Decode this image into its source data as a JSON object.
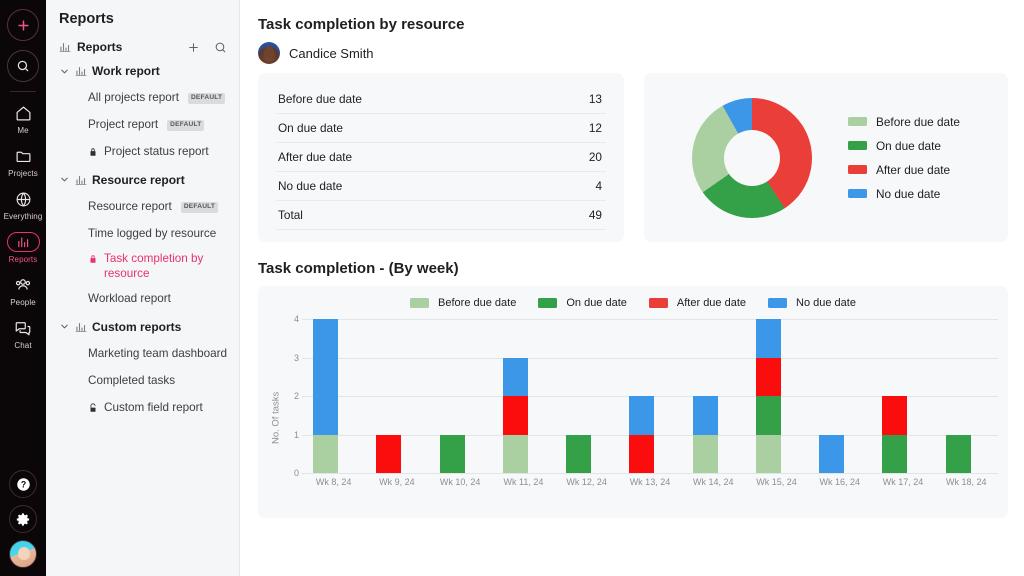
{
  "rail": {
    "add_label": "add-new",
    "search_label": "search",
    "items": [
      {
        "label": "Me",
        "icon": "home-icon",
        "active": false
      },
      {
        "label": "Projects",
        "icon": "folder-icon",
        "active": false
      },
      {
        "label": "Everything",
        "icon": "globe-icon",
        "active": false
      },
      {
        "label": "Reports",
        "icon": "bar-chart-icon",
        "active": true
      },
      {
        "label": "People",
        "icon": "people-icon",
        "active": false
      },
      {
        "label": "Chat",
        "icon": "chat-icon",
        "active": false
      }
    ],
    "bottom": [
      {
        "label": "Help",
        "icon": "help-icon"
      },
      {
        "label": "Settings",
        "icon": "gear-icon"
      },
      {
        "label": "Profile",
        "icon": "avatar-icon"
      }
    ]
  },
  "sidebar": {
    "title": "Reports",
    "root": {
      "label": "Reports",
      "add_icon": "plus-icon",
      "search_icon": "search-icon"
    },
    "groups": [
      {
        "label": "Work report",
        "items": [
          {
            "label": "All projects report",
            "badge": "DEFAULT",
            "lock": false,
            "active": false
          },
          {
            "label": "Project report",
            "badge": "DEFAULT",
            "lock": false,
            "active": false
          },
          {
            "label": "Project status report",
            "badge": "",
            "lock": true,
            "active": false
          }
        ]
      },
      {
        "label": "Resource report",
        "items": [
          {
            "label": "Resource report",
            "badge": "DEFAULT",
            "lock": false,
            "active": false
          },
          {
            "label": "Time logged by resource",
            "badge": "",
            "lock": false,
            "active": false
          },
          {
            "label": "Task completion by resource",
            "badge": "",
            "lock": true,
            "active": true
          },
          {
            "label": "Workload report",
            "badge": "",
            "lock": false,
            "active": false
          }
        ]
      },
      {
        "label": "Custom reports",
        "items": [
          {
            "label": "Marketing team dashboard",
            "badge": "",
            "lock": false,
            "active": false
          },
          {
            "label": "Completed tasks",
            "badge": "",
            "lock": false,
            "active": false
          },
          {
            "label": "Custom field report",
            "badge": "",
            "lock": true,
            "active": false
          }
        ]
      }
    ]
  },
  "main": {
    "page_title": "Task completion by resource",
    "person_name": "Candice Smith",
    "section_title": "Task completion - (By week)"
  },
  "summary_table": {
    "rows": [
      {
        "label": "Before due date",
        "value": "13"
      },
      {
        "label": "On due date",
        "value": "12"
      },
      {
        "label": "After due date",
        "value": "20"
      },
      {
        "label": "No due date",
        "value": "4"
      },
      {
        "label": "Total",
        "value": "49"
      }
    ]
  },
  "colors": {
    "before_due": "#aacfa0",
    "on_due": "#34a048",
    "after_due": "#ea3f38",
    "no_due": "#3c97e8",
    "after_due_bar": "#fb0d0d",
    "accent_pink": "#e8336d"
  },
  "chart_data": [
    {
      "type": "pie",
      "title": "",
      "donut": true,
      "legend_position": "right",
      "labels": [
        "Before due date",
        "On due date",
        "After due date",
        "No due date"
      ],
      "values": [
        13,
        12,
        20,
        4
      ],
      "total": 49,
      "colors": [
        "#aacfa0",
        "#34a048",
        "#ea3f38",
        "#3c97e8"
      ],
      "draw_order": [
        "After due date",
        "On due date",
        "Before due date",
        "No due date"
      ],
      "start_angle_deg": 0
    },
    {
      "type": "bar",
      "stacked": true,
      "title": "Task completion - (By week)",
      "xlabel": "",
      "ylabel": "No. Of tasks",
      "ylim": [
        0,
        4
      ],
      "yticks": [
        0,
        1,
        2,
        3,
        4
      ],
      "grid": true,
      "legend_position": "top",
      "categories": [
        "Wk 8, 24",
        "Wk 9, 24",
        "Wk 10, 24",
        "Wk 11, 24",
        "Wk 12, 24",
        "Wk 13, 24",
        "Wk 14, 24",
        "Wk 15, 24",
        "Wk 16, 24",
        "Wk 17, 24",
        "Wk 18, 24"
      ],
      "series": [
        {
          "name": "Before due date",
          "color": "#aacfa0",
          "values": [
            1,
            0,
            0,
            1,
            0,
            0,
            1,
            1,
            0,
            0,
            0
          ]
        },
        {
          "name": "On due date",
          "color": "#34a048",
          "values": [
            0,
            0,
            1,
            0,
            1,
            0,
            0,
            1,
            0,
            1,
            1
          ]
        },
        {
          "name": "After due date",
          "color": "#fb0d0d",
          "values": [
            0,
            1,
            0,
            1,
            0,
            1,
            0,
            1,
            0,
            1,
            0
          ]
        },
        {
          "name": "No due date",
          "color": "#3c97e8",
          "values": [
            3,
            0,
            0,
            1,
            0,
            1,
            1,
            1,
            1,
            0,
            0
          ]
        }
      ],
      "totals": [
        4,
        1,
        1,
        3,
        1,
        2,
        2,
        4,
        1,
        2,
        1
      ]
    }
  ]
}
